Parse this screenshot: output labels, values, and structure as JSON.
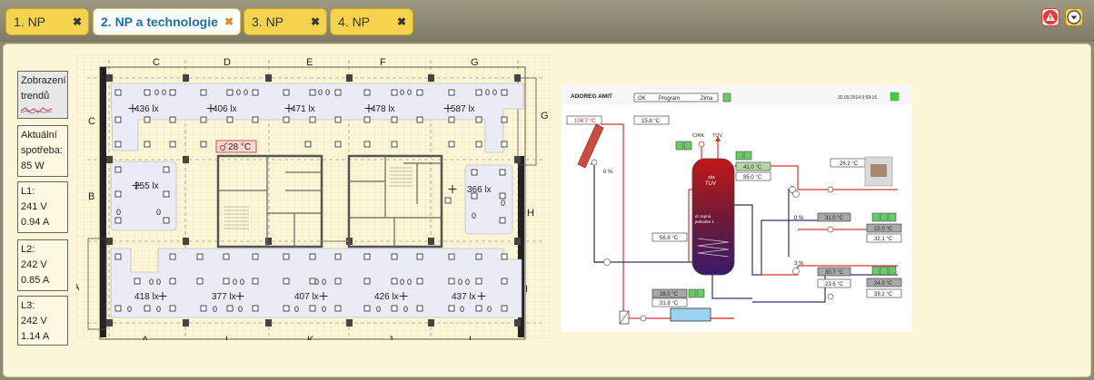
{
  "tabs": [
    {
      "label": "1. NP"
    },
    {
      "label": "2. NP a technologie"
    },
    {
      "label": "3. NP"
    },
    {
      "label": "4. NP"
    }
  ],
  "tab_close": "✖",
  "colors": {
    "tab": "#f5d34d",
    "active_tab_text": "#1d6fa8",
    "alert": "#e23b3b",
    "accent": "#f5c400",
    "panel": "#fdf6d6"
  },
  "sidebar": {
    "trends_label": "Zobrazení trendů",
    "power_label": "Aktuální spotřeba:",
    "power_value": "85 W",
    "phases": [
      {
        "name": "L1:",
        "voltage": "241 V",
        "current": "0.94 A"
      },
      {
        "name": "L2:",
        "voltage": "242 V",
        "current": "0.85 A"
      },
      {
        "name": "L3:",
        "voltage": "242 V",
        "current": "1.14 A"
      }
    ]
  },
  "floorplan": {
    "top_axes": [
      "C",
      "D",
      "E",
      "F",
      "G"
    ],
    "bottom_axes": [
      "A",
      "L",
      "K",
      "J",
      "I"
    ],
    "left_axes": [
      "C",
      "B",
      "A"
    ],
    "right_axes": [
      "G",
      "H",
      "I"
    ],
    "lux_top": [
      "436 lx",
      "406 lx",
      "471 lx",
      "478 lx",
      "587 lx"
    ],
    "lux_left": "255 lx",
    "lux_right": "366 lx",
    "lux_bottom": [
      "418 lx",
      "377 lx",
      "407 lx",
      "426 lx",
      "437 lx"
    ],
    "temperature": "28 °C",
    "zero": "0"
  },
  "tuv_panel": {
    "header_left": "ADOREG AMIT",
    "mode_ok": "OK",
    "mode_program": "Program",
    "mode_season": "Zima",
    "datetime": "30.09.2014 9:59:16",
    "solar_temp": "104.7 °C",
    "outdoor_temp": "15.8 °C",
    "solar_pct": "0 %",
    "cirk_label": "CIRK",
    "tuv_label": "TUV",
    "tank_title_1": "zás",
    "tank_title_2": "TUV",
    "tank_note_1": "el. topná",
    "tank_note_2": "jednotka 1",
    "tank_top_1": "41.0 °C",
    "tank_top_2": "85.0 °C",
    "tank_mid": "56.8 °C",
    "fireplace_temp": "26.2 °C",
    "circuit1_pct": "0 %",
    "circuit1_room": "31.0 °C",
    "circuit1_set": "22.0 °C",
    "circuit1_flow": "32.1 °C",
    "circuit2_pct": "3 %",
    "circuit2_room": "30.7 °C",
    "circuit2_flow": "23.6 °C",
    "circuit2_set": "24.0 °C",
    "circuit2_ret": "39.2 °C",
    "boiler_top": "28.0 °C",
    "boiler_bottom": "21.8 °C"
  }
}
